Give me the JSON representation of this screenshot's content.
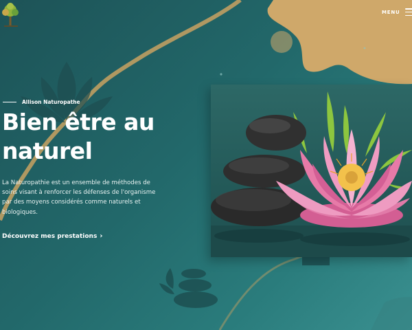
{
  "header": {
    "logo_icon": "tree-logo-icon",
    "menu_label": "MENU",
    "menu_icon": "hamburger-icon"
  },
  "hero": {
    "eyebrow": "Allison Naturopathe",
    "title_line1": "Bien être au",
    "title_line2": "naturel",
    "description": "La Naturopathie est un ensemble de méthodes de soins visant à renforcer les défenses de l'organisme par des moyens considérés comme naturels et biologiques.",
    "cta_label": "Découvrez mes prestations",
    "cta_icon": "chevron-right-icon"
  },
  "image": {
    "subject": "zen-stones-and-lotus-photo"
  },
  "colors": {
    "background": "#22686a",
    "accent_gold": "#cfa86a",
    "text": "#ffffff",
    "lotus_pink": "#e77aa8"
  }
}
